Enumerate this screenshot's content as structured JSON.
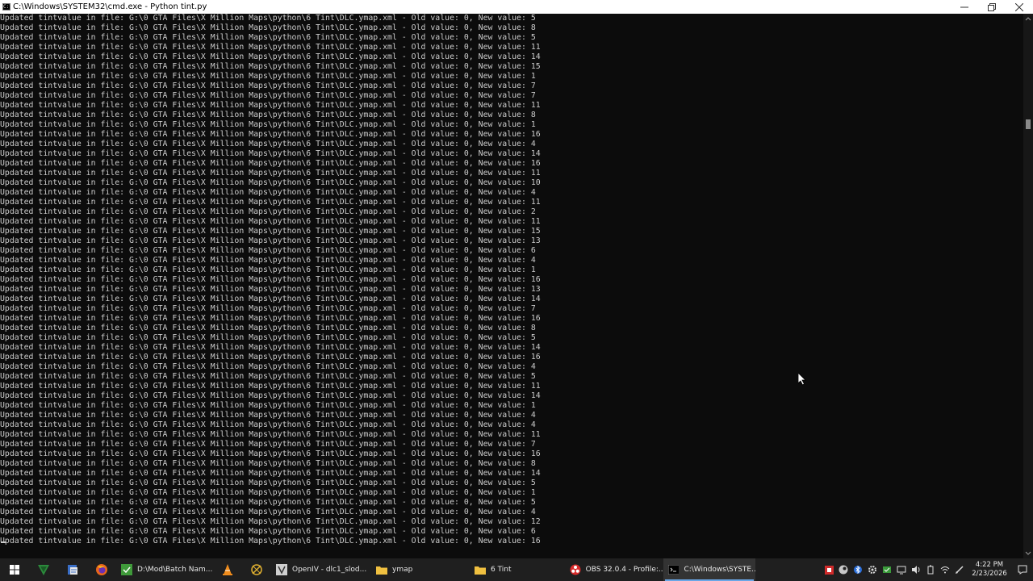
{
  "window": {
    "title": "C:\\Windows\\SYSTEM32\\cmd.exe - Python  tint.py",
    "icon_text": "C:\\"
  },
  "console": {
    "lines": [
      "Updated tintvalue in file: G:\\0 GTA Files\\X Million Maps\\python\\6 Tint\\DLC.ymap.xml - Old value: 0, New value: 5",
      "Updated tintvalue in file: G:\\0 GTA Files\\X Million Maps\\python\\6 Tint\\DLC.ymap.xml - Old value: 0, New value: 8",
      "Updated tintvalue in file: G:\\0 GTA Files\\X Million Maps\\python\\6 Tint\\DLC.ymap.xml - Old value: 0, New value: 5",
      "Updated tintvalue in file: G:\\0 GTA Files\\X Million Maps\\python\\6 Tint\\DLC.ymap.xml - Old value: 0, New value: 11",
      "Updated tintvalue in file: G:\\0 GTA Files\\X Million Maps\\python\\6 Tint\\DLC.ymap.xml - Old value: 0, New value: 14",
      "Updated tintvalue in file: G:\\0 GTA Files\\X Million Maps\\python\\6 Tint\\DLC.ymap.xml - Old value: 0, New value: 15",
      "Updated tintvalue in file: G:\\0 GTA Files\\X Million Maps\\python\\6 Tint\\DLC.ymap.xml - Old value: 0, New value: 1",
      "Updated tintvalue in file: G:\\0 GTA Files\\X Million Maps\\python\\6 Tint\\DLC.ymap.xml - Old value: 0, New value: 7",
      "Updated tintvalue in file: G:\\0 GTA Files\\X Million Maps\\python\\6 Tint\\DLC.ymap.xml - Old value: 0, New value: 7",
      "Updated tintvalue in file: G:\\0 GTA Files\\X Million Maps\\python\\6 Tint\\DLC.ymap.xml - Old value: 0, New value: 11",
      "Updated tintvalue in file: G:\\0 GTA Files\\X Million Maps\\python\\6 Tint\\DLC.ymap.xml - Old value: 0, New value: 8",
      "Updated tintvalue in file: G:\\0 GTA Files\\X Million Maps\\python\\6 Tint\\DLC.ymap.xml - Old value: 0, New value: 1",
      "Updated tintvalue in file: G:\\0 GTA Files\\X Million Maps\\python\\6 Tint\\DLC.ymap.xml - Old value: 0, New value: 16",
      "Updated tintvalue in file: G:\\0 GTA Files\\X Million Maps\\python\\6 Tint\\DLC.ymap.xml - Old value: 0, New value: 4",
      "Updated tintvalue in file: G:\\0 GTA Files\\X Million Maps\\python\\6 Tint\\DLC.ymap.xml - Old value: 0, New value: 14",
      "Updated tintvalue in file: G:\\0 GTA Files\\X Million Maps\\python\\6 Tint\\DLC.ymap.xml - Old value: 0, New value: 16",
      "Updated tintvalue in file: G:\\0 GTA Files\\X Million Maps\\python\\6 Tint\\DLC.ymap.xml - Old value: 0, New value: 11",
      "Updated tintvalue in file: G:\\0 GTA Files\\X Million Maps\\python\\6 Tint\\DLC.ymap.xml - Old value: 0, New value: 10",
      "Updated tintvalue in file: G:\\0 GTA Files\\X Million Maps\\python\\6 Tint\\DLC.ymap.xml - Old value: 0, New value: 4",
      "Updated tintvalue in file: G:\\0 GTA Files\\X Million Maps\\python\\6 Tint\\DLC.ymap.xml - Old value: 0, New value: 11",
      "Updated tintvalue in file: G:\\0 GTA Files\\X Million Maps\\python\\6 Tint\\DLC.ymap.xml - Old value: 0, New value: 2",
      "Updated tintvalue in file: G:\\0 GTA Files\\X Million Maps\\python\\6 Tint\\DLC.ymap.xml - Old value: 0, New value: 11",
      "Updated tintvalue in file: G:\\0 GTA Files\\X Million Maps\\python\\6 Tint\\DLC.ymap.xml - Old value: 0, New value: 15",
      "Updated tintvalue in file: G:\\0 GTA Files\\X Million Maps\\python\\6 Tint\\DLC.ymap.xml - Old value: 0, New value: 13",
      "Updated tintvalue in file: G:\\0 GTA Files\\X Million Maps\\python\\6 Tint\\DLC.ymap.xml - Old value: 0, New value: 6",
      "Updated tintvalue in file: G:\\0 GTA Files\\X Million Maps\\python\\6 Tint\\DLC.ymap.xml - Old value: 0, New value: 4",
      "Updated tintvalue in file: G:\\0 GTA Files\\X Million Maps\\python\\6 Tint\\DLC.ymap.xml - Old value: 0, New value: 1",
      "Updated tintvalue in file: G:\\0 GTA Files\\X Million Maps\\python\\6 Tint\\DLC.ymap.xml - Old value: 0, New value: 16",
      "Updated tintvalue in file: G:\\0 GTA Files\\X Million Maps\\python\\6 Tint\\DLC.ymap.xml - Old value: 0, New value: 13",
      "Updated tintvalue in file: G:\\0 GTA Files\\X Million Maps\\python\\6 Tint\\DLC.ymap.xml - Old value: 0, New value: 14",
      "Updated tintvalue in file: G:\\0 GTA Files\\X Million Maps\\python\\6 Tint\\DLC.ymap.xml - Old value: 0, New value: 7",
      "Updated tintvalue in file: G:\\0 GTA Files\\X Million Maps\\python\\6 Tint\\DLC.ymap.xml - Old value: 0, New value: 16",
      "Updated tintvalue in file: G:\\0 GTA Files\\X Million Maps\\python\\6 Tint\\DLC.ymap.xml - Old value: 0, New value: 8",
      "Updated tintvalue in file: G:\\0 GTA Files\\X Million Maps\\python\\6 Tint\\DLC.ymap.xml - Old value: 0, New value: 5",
      "Updated tintvalue in file: G:\\0 GTA Files\\X Million Maps\\python\\6 Tint\\DLC.ymap.xml - Old value: 0, New value: 14",
      "Updated tintvalue in file: G:\\0 GTA Files\\X Million Maps\\python\\6 Tint\\DLC.ymap.xml - Old value: 0, New value: 16",
      "Updated tintvalue in file: G:\\0 GTA Files\\X Million Maps\\python\\6 Tint\\DLC.ymap.xml - Old value: 0, New value: 4",
      "Updated tintvalue in file: G:\\0 GTA Files\\X Million Maps\\python\\6 Tint\\DLC.ymap.xml - Old value: 0, New value: 5",
      "Updated tintvalue in file: G:\\0 GTA Files\\X Million Maps\\python\\6 Tint\\DLC.ymap.xml - Old value: 0, New value: 11",
      "Updated tintvalue in file: G:\\0 GTA Files\\X Million Maps\\python\\6 Tint\\DLC.ymap.xml - Old value: 0, New value: 14",
      "Updated tintvalue in file: G:\\0 GTA Files\\X Million Maps\\python\\6 Tint\\DLC.ymap.xml - Old value: 0, New value: 1",
      "Updated tintvalue in file: G:\\0 GTA Files\\X Million Maps\\python\\6 Tint\\DLC.ymap.xml - Old value: 0, New value: 4",
      "Updated tintvalue in file: G:\\0 GTA Files\\X Million Maps\\python\\6 Tint\\DLC.ymap.xml - Old value: 0, New value: 4",
      "Updated tintvalue in file: G:\\0 GTA Files\\X Million Maps\\python\\6 Tint\\DLC.ymap.xml - Old value: 0, New value: 11",
      "Updated tintvalue in file: G:\\0 GTA Files\\X Million Maps\\python\\6 Tint\\DLC.ymap.xml - Old value: 0, New value: 7",
      "Updated tintvalue in file: G:\\0 GTA Files\\X Million Maps\\python\\6 Tint\\DLC.ymap.xml - Old value: 0, New value: 16",
      "Updated tintvalue in file: G:\\0 GTA Files\\X Million Maps\\python\\6 Tint\\DLC.ymap.xml - Old value: 0, New value: 8",
      "Updated tintvalue in file: G:\\0 GTA Files\\X Million Maps\\python\\6 Tint\\DLC.ymap.xml - Old value: 0, New value: 14",
      "Updated tintvalue in file: G:\\0 GTA Files\\X Million Maps\\python\\6 Tint\\DLC.ymap.xml - Old value: 0, New value: 5",
      "Updated tintvalue in file: G:\\0 GTA Files\\X Million Maps\\python\\6 Tint\\DLC.ymap.xml - Old value: 0, New value: 1",
      "Updated tintvalue in file: G:\\0 GTA Files\\X Million Maps\\python\\6 Tint\\DLC.ymap.xml - Old value: 0, New value: 5",
      "Updated tintvalue in file: G:\\0 GTA Files\\X Million Maps\\python\\6 Tint\\DLC.ymap.xml - Old value: 0, New value: 4",
      "Updated tintvalue in file: G:\\0 GTA Files\\X Million Maps\\python\\6 Tint\\DLC.ymap.xml - Old value: 0, New value: 12",
      "Updated tintvalue in file: G:\\0 GTA Files\\X Million Maps\\python\\6 Tint\\DLC.ymap.xml - Old value: 0, New value: 6",
      "Updated tintvalue in file: G:\\0 GTA Files\\X Million Maps\\python\\6 Tint\\DLC.ymap.xml - Old value: 0, New value: 16"
    ]
  },
  "taskbar": {
    "pinned_icons": [
      "windows-start-icon",
      "vim-icon",
      "python-editor-icon",
      "firefox-icon",
      "notepad-plus-plus-icon"
    ],
    "apps": [
      {
        "id": "batch-namer",
        "label": "D:\\Mod\\Batch Nam...",
        "icon": "green-app-icon",
        "icon_color": "#3f9a3a",
        "active": false
      },
      {
        "id": "vlc",
        "label": "",
        "icon": "vlc-cone-icon",
        "icon_color": "#f08c1c",
        "active": false
      },
      {
        "id": "blender-like",
        "label": "",
        "icon": "tool-icon",
        "icon_color": "#e0b030",
        "active": false
      },
      {
        "id": "openiv",
        "label": "OpenIV - dlc1_slod...",
        "icon": "openiv-icon",
        "icon_color": "#d0d0d0",
        "active": false
      },
      {
        "id": "explorer-ymap",
        "label": "ymap",
        "icon": "folder-icon",
        "icon_color": "#f0c040",
        "active": false
      },
      {
        "id": "explorer-6tint",
        "label": "6 Tint",
        "icon": "folder-icon",
        "icon_color": "#f0c040",
        "active": false
      },
      {
        "id": "obs",
        "label": "OBS 32.0.4 - Profile:...",
        "icon": "obs-icon",
        "icon_color": "#d82b2b",
        "active": false
      },
      {
        "id": "cmd",
        "label": "C:\\Windows\\SYSTE...",
        "icon": "cmd-icon",
        "icon_color": "#000000",
        "active": true
      }
    ],
    "tray": {
      "time": "4:22 PM",
      "date": "2/23/2026"
    }
  },
  "colors": {
    "console_bg": "#0c0c0c",
    "console_text": "#cccccc",
    "taskbar_bg": "#1f1f1f",
    "active_underline": "#6aa6e6"
  }
}
